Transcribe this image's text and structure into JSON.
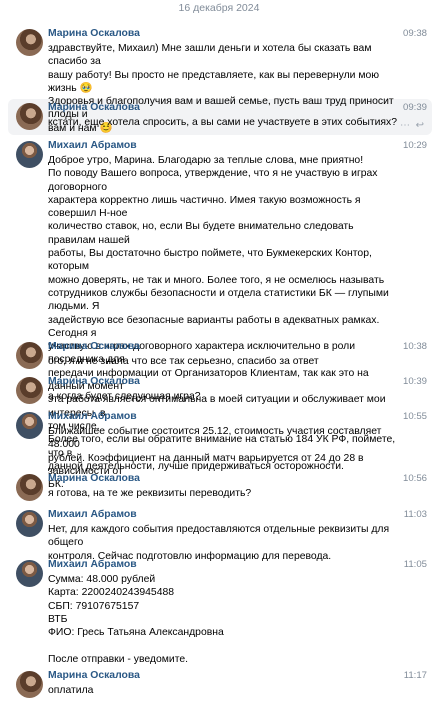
{
  "date_separator": "16 декабря 2024",
  "messages": [
    {
      "author": "Марина Оскалова",
      "time": "09:38",
      "text": "здравствуйте, Михаил) Мне зашли деньги и хотела бы сказать вам спасибо за\nвашу работу! Вы просто не представляете, как вы перевернули мою жизнь 🥹\nЗдоровья и благополучия вам и вашей семье, пусть ваш труд приносит плоды и\nвам и нам 😊"
    },
    {
      "author": "Марина Оскалова",
      "time": "09:39",
      "text": "кстати, еще хотела спросить, а вы сами не участвуете в этих событиях?"
    },
    {
      "author": "Михаил Абрамов",
      "time": "10:29",
      "text": "Доброе утро, Марина. Благодарю за теплые слова, мне приятно!\nПо поводу Вашего вопроса, утверждение, что я не участвую в играх договорного\nхарактера корректно лишь частично. Имея такую возможность я совершил Н-ное\nколичество ставок, но, если Вы будете внимательно следовать правилам нашей\nработы, Вы достаточно быстро поймете, что Букмекерских Контор, которым\nможно доверять, не так и много. Более того, я не осмелюсь называть\nсотрудников службы безопасности и отдела статистики БК — глупыми людьми. Я\nзадействую все безопасные варианты работы в адекватных рамках. Сегодня я\nучаствую в играх договорного характера исключительно в роли посредника для\nпередачи информации от Организаторов Клиентам, так как это на данный момент\nэта работа является оптимальна в моей ситуации и обслуживает мои интересы, в\nтом числе.\nБолее того, если вы обратите внимание на статью 184 УК РФ, поймете, что в\nданной деятельности, лучше придерживаться осторожности."
    },
    {
      "author": "Марина Оскалова",
      "time": "10:38",
      "text": "ого, я и не знала что все так серьезно, спасибо за ответ"
    },
    {
      "author": "Марина Оскалова",
      "time": "10:39",
      "text": "а когда будет следующая игра?"
    },
    {
      "author": "Михаил Абрамов",
      "time": "10:55",
      "text": "Ближайшее событие состоится 25.12, стоимость участия составляет 48.000\nрублей. Коэффициент на данный матч варьируется от 24 до 28 в зависимости от\nБК."
    },
    {
      "author": "Марина Оскалова",
      "time": "10:56",
      "text": "я готова, на те же реквизиты переводить?"
    },
    {
      "author": "Михаил Абрамов",
      "time": "11:03",
      "text": "Нет, для каждого события предоставляются отдельные реквизиты для общего\nконтроля. Сейчас подготовлю информацию для перевода."
    },
    {
      "author": "Михаил Абрамов",
      "time": "11:05",
      "text": "Сумма: 48.000 рублей\nКарта: 2200240243945488\nСБП: 79107675157\nВТБ\nФИО: Гресь Татьяна Александровна\n\nПосле отправки - уведомите."
    },
    {
      "author": "Марина Оскалова",
      "time": "11:17",
      "text": "оплатила"
    }
  ]
}
